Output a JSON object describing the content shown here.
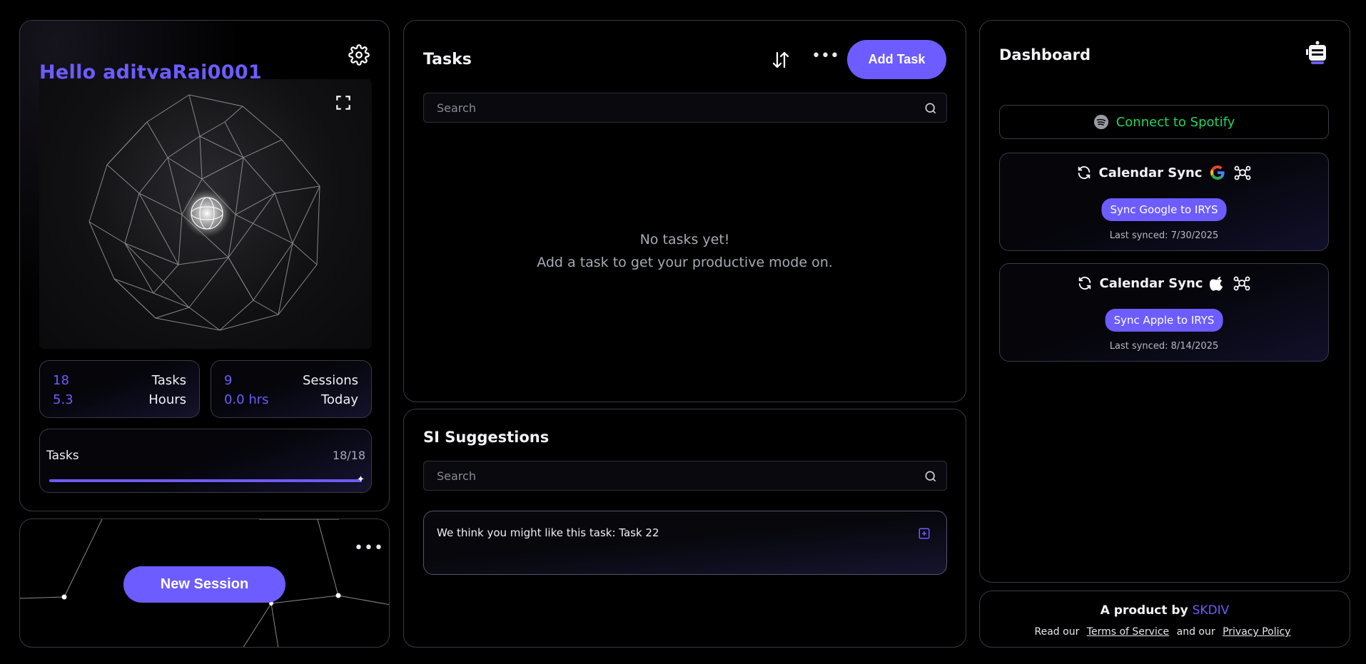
{
  "profile": {
    "greeting": "Hello adityaRaj0001",
    "stats": {
      "tasks_count": "18",
      "tasks_label": "Tasks",
      "hours_count": "5.3",
      "hours_label": "Hours",
      "sessions_count": "9",
      "sessions_label": "Sessions",
      "today_count": "0.0 hrs",
      "today_label": "Today"
    },
    "progress": {
      "label": "Tasks",
      "count": "18/18",
      "fraction": 1.0
    }
  },
  "session": {
    "new_session_label": "New Session"
  },
  "tasks": {
    "title": "Tasks",
    "add_label": "Add Task",
    "search_placeholder": "Search",
    "empty_line1": "No tasks yet!",
    "empty_line2": "Add a task to get your productive mode on."
  },
  "suggestions": {
    "title": "SI Suggestions",
    "search_placeholder": "Search",
    "items": [
      {
        "text": "We think you might like this task: Task 22"
      }
    ]
  },
  "dashboard": {
    "title": "Dashboard",
    "spotify_label": "Connect to Spotify",
    "calendars": [
      {
        "heading": "Calendar Sync",
        "provider_icon": "google-icon",
        "button_label": "Sync Google to IRYS",
        "last_synced": "Last synced: 7/30/2025"
      },
      {
        "heading": "Calendar Sync",
        "provider_icon": "apple-icon",
        "button_label": "Sync Apple to IRYS",
        "last_synced": "Last synced: 8/14/2025"
      }
    ]
  },
  "footer": {
    "product_prefix": "A product by",
    "brand": "SKDIV",
    "read_our": "Read our",
    "terms": "Terms of Service",
    "and_our": "and our",
    "privacy": "Privacy Policy"
  },
  "colors": {
    "accent": "#6d5cff",
    "spotify": "#1ed760",
    "background": "#000000"
  }
}
